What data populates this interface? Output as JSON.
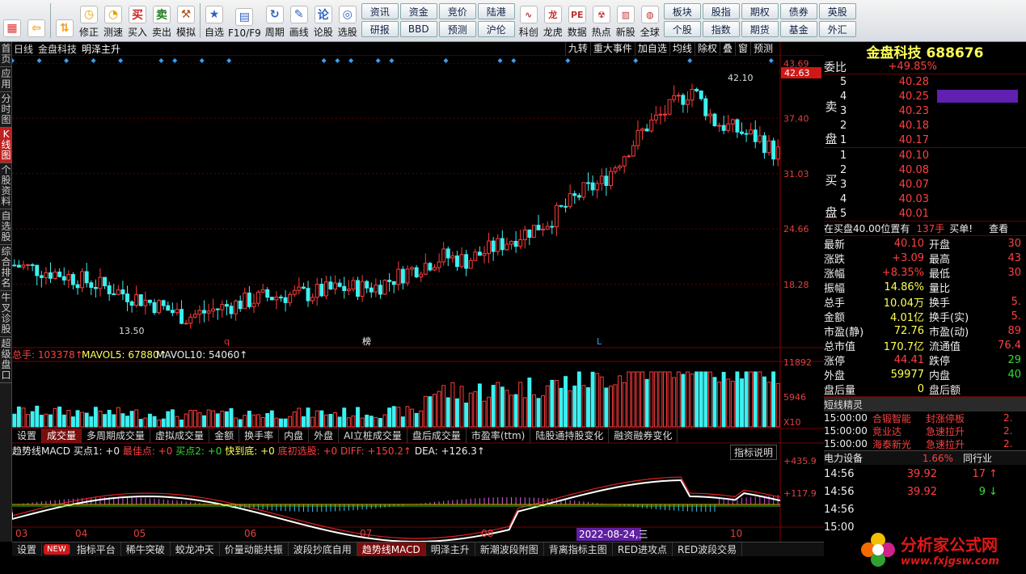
{
  "toolbar": {
    "items": [
      {
        "label": "",
        "icon": "grid-icon",
        "color": "#e03030"
      },
      {
        "label": "",
        "icon": "back-arrow-icon",
        "color": "#f0a020"
      },
      {
        "label": "",
        "icon": "up-down-arrows-icon",
        "color": "#f0a020"
      },
      {
        "label": "修正",
        "icon": "clock-icon",
        "color": "#e0a000"
      },
      {
        "label": "测速",
        "icon": "stopwatch-icon",
        "color": "#e0a000"
      },
      {
        "label": "买入",
        "icon": "buy-icon",
        "color": "#d02020"
      },
      {
        "label": "卖出",
        "icon": "sell-icon",
        "color": "#208020"
      },
      {
        "label": "模拟",
        "icon": "hammer-icon",
        "color": "#b05010"
      },
      {
        "label": "自选",
        "icon": "star-icon",
        "color": "#3060c0"
      },
      {
        "label": "F10/F9",
        "icon": "f10-icon",
        "color": "#3060c0"
      },
      {
        "label": "周期",
        "icon": "cycle-icon",
        "color": "#3060c0"
      },
      {
        "label": "画线",
        "icon": "pencil-icon",
        "color": "#3060c0"
      },
      {
        "label": "论股",
        "icon": "discuss-icon",
        "color": "#3060c0"
      },
      {
        "label": "选股",
        "icon": "select-stock-icon",
        "color": "#3060c0"
      }
    ],
    "grid": [
      "资讯",
      "资金",
      "竞价",
      "陆港",
      "研报",
      "BBD",
      "预测",
      "沪伦"
    ],
    "items2": [
      {
        "label": "科创",
        "icon": "kechuang-icon"
      },
      {
        "label": "龙虎",
        "icon": "dragon-tiger-icon"
      },
      {
        "label": "数据",
        "icon": "pe-data-icon"
      },
      {
        "label": "热点",
        "icon": "hot-icon"
      },
      {
        "label": "新股",
        "icon": "new-stock-icon"
      },
      {
        "label": "全球",
        "icon": "globe-icon"
      }
    ],
    "grid2": [
      "板块",
      "股指",
      "期权",
      "债券",
      "英股",
      "个股",
      "指数",
      "期货",
      "基金",
      "外汇"
    ]
  },
  "lefttabs": [
    "首页",
    "应用",
    "分时图",
    "K线图",
    "个股资料",
    "自选股",
    "综合排名",
    "牛叉诊股",
    "超级盘口"
  ],
  "chart": {
    "period": "日线",
    "name": "金盘科技",
    "indicator_name": "明泽主升",
    "tools": [
      "九转",
      "重大事件",
      "加自选",
      "均线",
      "除权",
      "叠",
      "窗",
      "预测"
    ],
    "price_ticks": [
      "43.69",
      "37.40",
      "31.03",
      "24.66",
      "18.28"
    ],
    "last_price_tag": "42.63",
    "high_label": "42.10",
    "low_label": "13.50",
    "markers": [
      "q",
      "榜",
      "L"
    ],
    "vol_legend": {
      "total": "总手: 103378↑",
      "ma5": "MAVOL5: 67880↑",
      "ma10": "MAVOL10: 54060↑"
    },
    "vol_ticks": [
      "11892",
      "5946",
      "X10"
    ],
    "tabs": [
      "设置",
      "成交量",
      "多周期成交量",
      "虚拟成交量",
      "金额",
      "换手率",
      "内盘",
      "外盘",
      "AI立桩成交量",
      "盘后成交量",
      "市盈率(ttm)",
      "陆股通持股变化",
      "融资融券变化"
    ],
    "macd_legend": {
      "name": "趋势线MACD",
      "b1": "买点1: +0",
      "b2": "最佳点: +0",
      "b3": "买点2: +0",
      "b4": "快到底: +0",
      "b5": "底初选股: +0",
      "diff": "DIFF: +150.2↑",
      "dea": "DEA: +126.3↑"
    },
    "macd_help": "指标说明",
    "macd_ticks": [
      "+435.9",
      "+117.9"
    ],
    "months": [
      "03",
      "04",
      "05",
      "06",
      "07",
      "08",
      "10"
    ],
    "cursor_date": "2022-08-24,三"
  },
  "chart_data": {
    "type": "candlestick",
    "ylim": [
      11,
      44.5
    ],
    "days": 170,
    "series": [
      {
        "name": "K线",
        "ohlc_anchor": [
          [
            0,
            20.5
          ],
          [
            10,
            19.5
          ],
          [
            20,
            18.0
          ],
          [
            30,
            16.2
          ],
          [
            38,
            14.5
          ],
          [
            45,
            15.5
          ],
          [
            55,
            16.8
          ],
          [
            65,
            17.2
          ],
          [
            72,
            17.8
          ],
          [
            80,
            18.0
          ],
          [
            88,
            20.0
          ],
          [
            95,
            21.5
          ],
          [
            100,
            21.0
          ],
          [
            108,
            23.0
          ],
          [
            118,
            25.5
          ],
          [
            126,
            29.0
          ],
          [
            130,
            30.0
          ],
          [
            136,
            34.0
          ],
          [
            140,
            36.5
          ],
          [
            145,
            38.5
          ],
          [
            150,
            40.8
          ],
          [
            155,
            37.0
          ],
          [
            160,
            36.0
          ],
          [
            165,
            35.0
          ],
          [
            168,
            33.5
          ]
        ]
      }
    ]
  },
  "info": {
    "title": "金盘科技 688676",
    "weibi_label": "委比",
    "weibi": "+49.85%",
    "sell_label": "卖盘",
    "sell": [
      [
        "5",
        "40.28"
      ],
      [
        "4",
        "40.25"
      ],
      [
        "3",
        "40.23"
      ],
      [
        "2",
        "40.18"
      ],
      [
        "1",
        "40.17"
      ]
    ],
    "buy_label": "买盘",
    "buy": [
      [
        "1",
        "40.10"
      ],
      [
        "2",
        "40.08"
      ],
      [
        "3",
        "40.07"
      ],
      [
        "4",
        "40.03"
      ],
      [
        "5",
        "40.01"
      ]
    ],
    "ticker_note": "在买盘40.00位置有",
    "ticker_count": "137手",
    "ticker_action": "买单!",
    "ticker_more": "查看",
    "stats": [
      [
        "最新",
        "40.10",
        "开盘",
        "30"
      ],
      [
        "涨跌",
        "+3.09",
        "最高",
        "43"
      ],
      [
        "涨幅",
        "+8.35%",
        "最低",
        "30"
      ],
      [
        "振幅",
        "14.86%",
        "量比",
        ""
      ],
      [
        "总手",
        "10.04万",
        "换手",
        "5."
      ],
      [
        "金额",
        "4.01亿",
        "换手(实)",
        "5."
      ],
      [
        "市盈(静)",
        "72.76",
        "市盈(动)",
        "89"
      ],
      [
        "总市值",
        "170.7亿",
        "流通值",
        "76.4"
      ],
      [
        "涨停",
        "44.41",
        "跌停",
        "29"
      ],
      [
        "外盘",
        "59977",
        "内盘",
        "40"
      ],
      [
        "盘后量",
        "0",
        "盘后额",
        ""
      ]
    ],
    "short_title": "短线精灵",
    "short": [
      [
        "15:00:00",
        "合锻智能",
        "封涨停板",
        "2."
      ],
      [
        "15:00:00",
        "竞业达",
        "急速拉升",
        "2."
      ],
      [
        "15:00:00",
        "海泰新光",
        "急速拉升",
        "2."
      ]
    ],
    "power_label": "电力设备",
    "power_pct": "1.66%",
    "power_more": "同行业",
    "trades": [
      [
        "14:56",
        "39.92",
        "17"
      ],
      [
        "14:56",
        "39.92",
        "9"
      ],
      [
        "14:56",
        "",
        ""
      ],
      [
        "15:00",
        "",
        ""
      ]
    ]
  },
  "bottomtabs": [
    "设置",
    "NEW",
    "指标平台",
    "稀牛突破",
    "蛟龙冲天",
    "价量动能共振",
    "波段抄底自用",
    "趋势线MACD",
    "明泽主升",
    "新潮波段附图",
    "背离指标主图",
    "RED进攻点",
    "RED波段交易"
  ],
  "watermark": {
    "title": "分析家公式网",
    "url": "www.fxjgsw.com"
  }
}
